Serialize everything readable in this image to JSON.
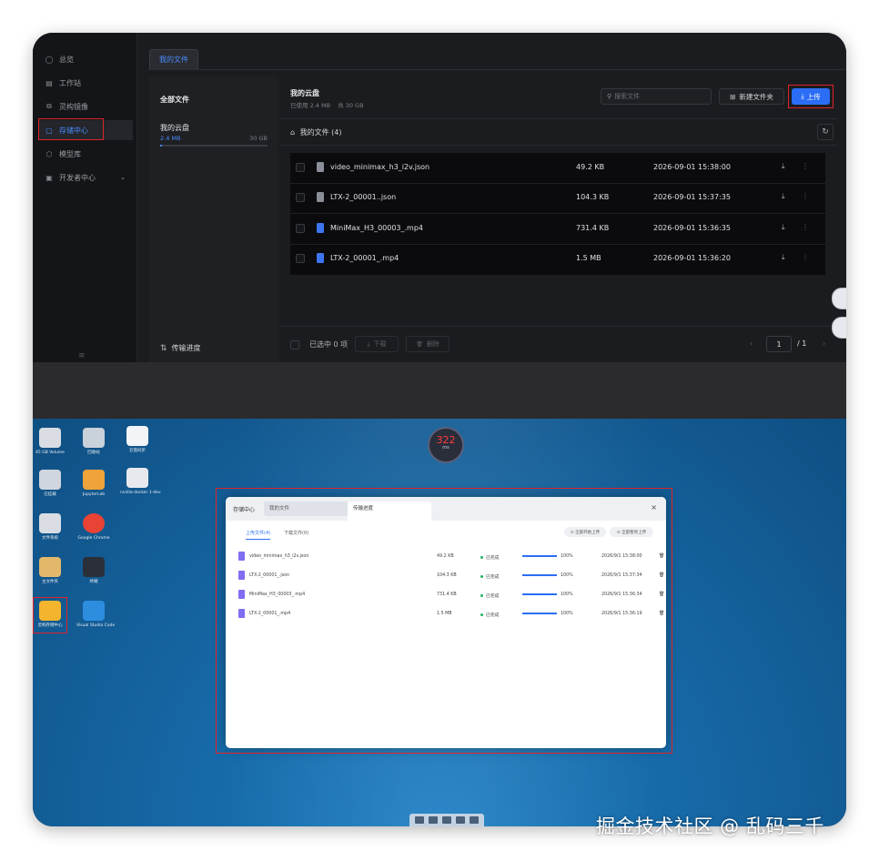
{
  "nav": {
    "items": [
      {
        "label": "总览",
        "icon": "overview-icon",
        "glyph": "◯"
      },
      {
        "label": "工作站",
        "icon": "workstation-icon",
        "glyph": "▤"
      },
      {
        "label": "灵构镜像",
        "icon": "image-icon",
        "glyph": "⧉"
      },
      {
        "label": "存储中心",
        "icon": "folder-icon",
        "glyph": "▢"
      },
      {
        "label": "模型库",
        "icon": "model-icon",
        "glyph": "⬡"
      },
      {
        "label": "开发者中心",
        "icon": "developer-icon",
        "glyph": "▣",
        "caret": "⌄"
      }
    ],
    "bottom_glyph": "≡"
  },
  "tabs": {
    "active": "我的文件"
  },
  "storage": {
    "title": "全部文件",
    "cloud_label": "我的云盘",
    "used": "2.4 MB",
    "total": "30 GB",
    "used_fraction": 0.0001,
    "transfer_label": "传输进度",
    "transfer_glyph": "⇅"
  },
  "main": {
    "title": "我的云盘",
    "used_text": "已使用 2.4 MB",
    "total_text": "共 30 GB",
    "search_placeholder": "搜索文件",
    "search_glyph": "⚲",
    "new_folder_label": "新建文件夹",
    "new_folder_glyph": "⊞",
    "upload_label": "上传",
    "upload_glyph": "⤓",
    "breadcrumb": "我的文件 (4)",
    "home_glyph": "⌂",
    "refresh_glyph": "↻"
  },
  "files": [
    {
      "name": "video_minimax_h3_i2v.json",
      "size": "49.2 KB",
      "date": "2026-09-01 15:38:00",
      "type": "doc"
    },
    {
      "name": "LTX-2_00001..json",
      "size": "104.3 KB",
      "date": "2026-09-01 15:37:35",
      "type": "doc"
    },
    {
      "name": "MiniMax_H3_00003_.mp4",
      "size": "731.4 KB",
      "date": "2026-09-01 15:36:35",
      "type": "video"
    },
    {
      "name": "LTX-2_00001_.mp4",
      "size": "1.5 MB",
      "date": "2026-09-01 15:36:20",
      "type": "video"
    }
  ],
  "row_actions": {
    "download_glyph": "⤓",
    "more_glyph": "⋮"
  },
  "footer": {
    "selected": "已选中 0 项",
    "download": "下载",
    "delete": "删除",
    "page": "1",
    "total": "/ 1",
    "prev": "‹",
    "next": "›"
  },
  "desktop": {
    "ping_value": "322",
    "ping_unit": "ms",
    "icons": [
      {
        "label": "45 GB Volume",
        "color": "#d9dde3"
      },
      {
        "label": "回收站",
        "color": "#c9d1da"
      },
      {
        "label": "云盘同步",
        "color": "#f2f4f7"
      },
      {
        "label": "已挂载",
        "color": "#cfd6de"
      },
      {
        "label": "JupyterLab",
        "color": "#f0a33a"
      },
      {
        "label": "nvidia-docker 1-dev",
        "color": "#e7e9ee"
      },
      {
        "label": "文件系统",
        "color": "#d9dde3"
      },
      {
        "label": "Google Chrome",
        "color": "#e94335"
      },
      {
        "label": "主文件夹",
        "color": "#e2b86a"
      },
      {
        "label": "终端",
        "color": "#2b2f38"
      },
      {
        "label": "灵构存储中心",
        "color": "#f4b52e"
      },
      {
        "label": "Visual Studio Code",
        "color": "#2d8ee0"
      }
    ]
  },
  "transfer_window": {
    "title": "存储中心",
    "tab1": "我的文件",
    "tab2": "传输进度",
    "close_glyph": "×",
    "subtab_upload": "上传文件(4)",
    "subtab_download": "下载文件(0)",
    "btn_start_all": "⊙ 全部开始上传",
    "btn_pause_all": "⊙ 全部暂停上传",
    "status": "已完成",
    "delete_glyph": "🗑",
    "rows": [
      {
        "name": "video_minimax_h3_i2v.json",
        "size": "49.2 KB",
        "progress": "100%",
        "progress_value": 1.0,
        "date": "2026/9/1 15:38:00"
      },
      {
        "name": "LTX-2_00001_.json",
        "size": "104.3 KB",
        "progress": "100%",
        "progress_value": 1.0,
        "date": "2026/9/1 15:37:34"
      },
      {
        "name": "MiniMax_H3_00003_.mp4",
        "size": "731.4 KB",
        "progress": "100%",
        "progress_value": 1.0,
        "date": "2026/9/1 15:36:34"
      },
      {
        "name": "LTX-2_00001_.mp4",
        "size": "1.5 MB",
        "progress": "100%",
        "progress_value": 1.0,
        "date": "2026/9/1 15:36:19"
      }
    ]
  },
  "watermark": "掘金技术社区 @ 乱码三千"
}
